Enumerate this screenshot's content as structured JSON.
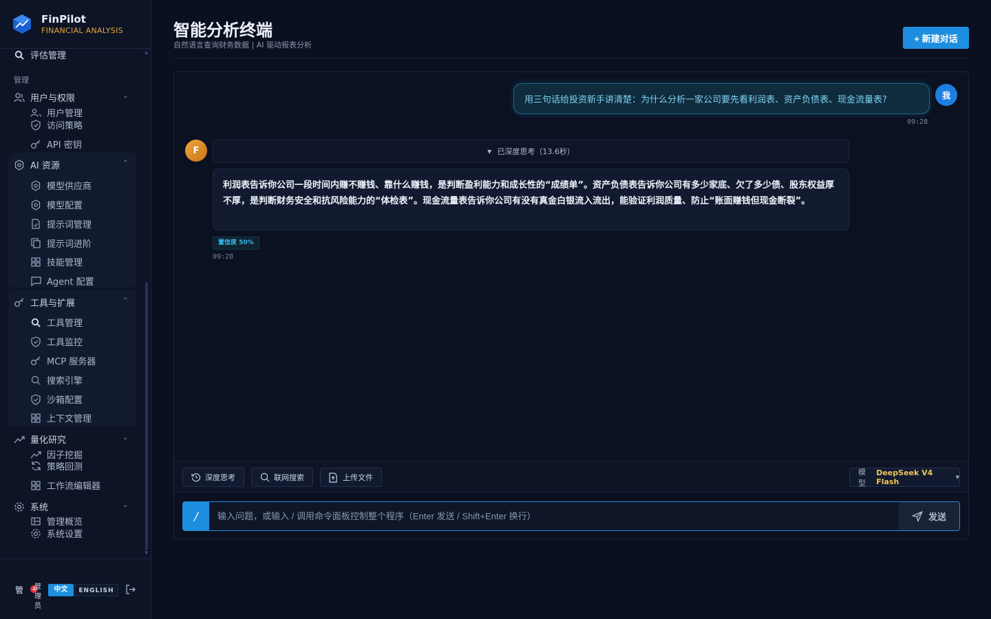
{
  "brand": {
    "name": "FinPilot",
    "subtitle": "FINANCIAL ANALYSIS"
  },
  "sidebar": {
    "top_item": {
      "label": "评估管理",
      "icon": "search-icon"
    },
    "section_label": "管理",
    "groups": [
      {
        "label": "用户与权限",
        "icon": "users-icon",
        "expanded": false,
        "items": [
          {
            "label": "用户管理",
            "icon": "users-icon"
          },
          {
            "label": "访问策略",
            "icon": "shield-icon"
          },
          {
            "label": "API 密钥",
            "icon": "key-icon"
          }
        ]
      },
      {
        "label": "AI 资源",
        "icon": "chip-icon",
        "expanded": true,
        "items": [
          {
            "label": "模型供应商",
            "icon": "chip-icon"
          },
          {
            "label": "模型配置",
            "icon": "chip-icon"
          },
          {
            "label": "提示词管理",
            "icon": "document-icon"
          },
          {
            "label": "提示词进阶",
            "icon": "copy-icon"
          },
          {
            "label": "技能管理",
            "icon": "grid-icon"
          },
          {
            "label": "Agent 配置",
            "icon": "chat-icon"
          }
        ]
      },
      {
        "label": "工具与扩展",
        "icon": "key-icon",
        "expanded": true,
        "items": [
          {
            "label": "工具管理",
            "icon": "search-icon"
          },
          {
            "label": "工具监控",
            "icon": "shield-icon"
          },
          {
            "label": "MCP 服务器",
            "icon": "key-icon"
          },
          {
            "label": "搜索引擎",
            "icon": "search-icon"
          },
          {
            "label": "沙箱配置",
            "icon": "shield-icon"
          },
          {
            "label": "上下文管理",
            "icon": "grid-icon"
          }
        ]
      },
      {
        "label": "量化研究",
        "icon": "trend-icon",
        "expanded": false,
        "items": [
          {
            "label": "因子挖掘",
            "icon": "trend-icon"
          },
          {
            "label": "策略回测",
            "icon": "refresh-icon"
          },
          {
            "label": "工作流编辑器",
            "icon": "grid-icon"
          }
        ]
      },
      {
        "label": "系统",
        "icon": "gear-icon",
        "expanded": false,
        "items": [
          {
            "label": "管理概览",
            "icon": "dashboard-icon"
          },
          {
            "label": "系统设置",
            "icon": "gear-icon"
          }
        ]
      }
    ],
    "footer": {
      "user_initial": "管",
      "notification_count": "4",
      "user_name": "管理员",
      "lang_zh": "中文",
      "lang_en": "ENGLISH"
    }
  },
  "header": {
    "title": "智能分析终端",
    "subtitle": "自然语言查询财务数据 | AI 驱动报表分析",
    "new_chat_label": "+ 新建对话"
  },
  "chat": {
    "user_message": {
      "text": "用三句话给投资新手讲清楚：为什么分析一家公司要先看利润表、资产负债表、现金流量表?",
      "avatar": "我",
      "time": "09:28"
    },
    "bot_message": {
      "avatar": "F",
      "thinking_label": "已深度思考（13.6秒）",
      "text": "利润表告诉你公司一段时间内赚不赚钱、靠什么赚钱，是判断盈利能力和成长性的“成绩单”。资产负债表告诉你公司有多少家底、欠了多少债、股东权益厚不厚，是判断财务安全和抗风险能力的“体检表”。现金流量表告诉你公司有没有真金白银流入流出，能验证利润质量、防止“账面赚钱但现金断裂”。",
      "confidence": "置信度 50%",
      "confidence_value": 0.5,
      "time": "09:28"
    }
  },
  "toolbar": {
    "deep_think": "深度思考",
    "web_search": "联网搜索",
    "upload": "上传文件",
    "model_label": "模型",
    "model_value": "DeepSeek V4 Flash"
  },
  "composer": {
    "slash": "/",
    "placeholder": "输入问题，或输入 / 调用命令面板控制整个程序（Enter 发送 / Shift+Enter 换行）",
    "send_label": "发送"
  },
  "colors": {
    "accent": "#1e8fe0",
    "brand_orange": "#e5a53b",
    "model_gold": "#f0c65a",
    "background": "#0b1020"
  }
}
